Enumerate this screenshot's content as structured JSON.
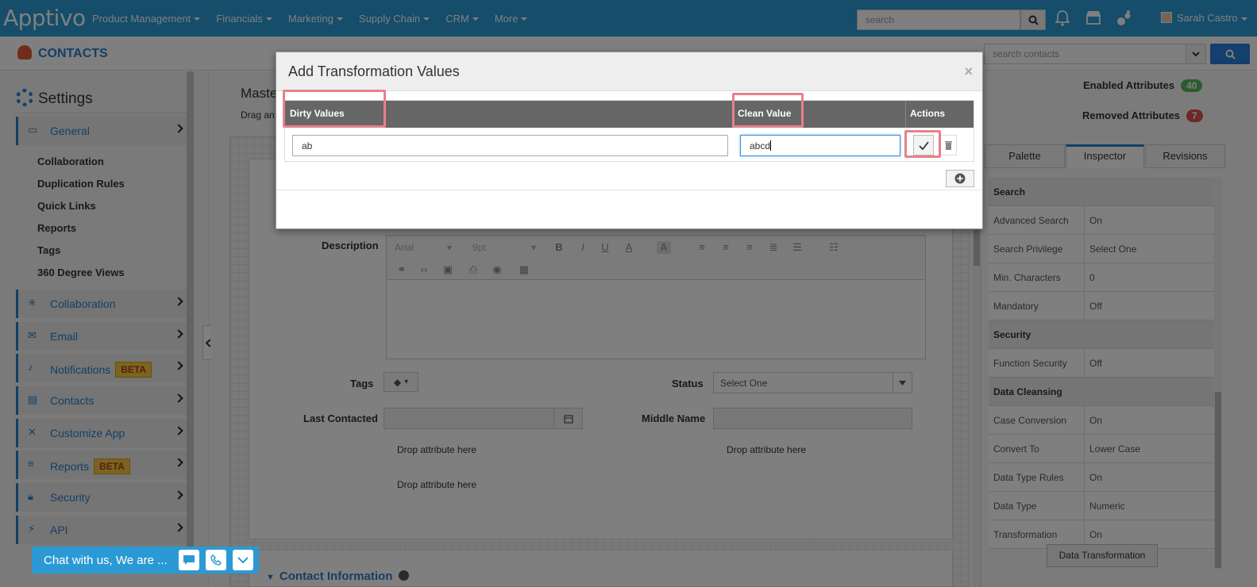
{
  "topnav": {
    "logo": "Apptivo",
    "items": [
      "Product Management",
      "Financials",
      "Marketing",
      "Supply Chain",
      "CRM",
      "More"
    ],
    "search_placeholder": "search",
    "user": "Sarah Castro"
  },
  "subbar": {
    "title": "CONTACTS",
    "contact_search_placeholder": "search contacts"
  },
  "sidebar": {
    "heading": "Settings",
    "general": "General",
    "sub_items": [
      "Collaboration",
      "Duplication Rules",
      "Quick Links",
      "Reports",
      "Tags",
      "360 Degree Views"
    ],
    "items": [
      {
        "label": "Collaboration",
        "icon": "collaboration-icon"
      },
      {
        "label": "Email",
        "icon": "envelope-icon"
      },
      {
        "label": "Notifications",
        "icon": "bell-icon",
        "badge": "BETA"
      },
      {
        "label": "Contacts",
        "icon": "contacts-card-icon"
      },
      {
        "label": "Customize App",
        "icon": "tools-icon"
      },
      {
        "label": "Reports",
        "icon": "reports-icon",
        "badge": "BETA"
      },
      {
        "label": "Security",
        "icon": "lock-icon"
      },
      {
        "label": "API",
        "icon": "plug-icon"
      }
    ]
  },
  "main": {
    "title": "Maste",
    "subtitle": "Drag an",
    "description_label": "Description",
    "editor": {
      "font": "Arial",
      "size": "9pt"
    },
    "tags_label": "Tags",
    "status_label": "Status",
    "status_value": "Select One",
    "last_contacted_label": "Last Contacted",
    "middle_name_label": "Middle Name",
    "drop_text": "Drop attribute here",
    "section": "Contact Information"
  },
  "right": {
    "enabled_label": "Enabled Attributes",
    "enabled_count": "40",
    "removed_label": "Removed Attributes",
    "removed_count": "7",
    "tabs": [
      "Palette",
      "Inspector",
      "Revisions"
    ],
    "inspector": [
      {
        "k": "Search",
        "head": true
      },
      {
        "k": "Advanced Search",
        "v": "On"
      },
      {
        "k": "Search Privilege",
        "v": "Select One"
      },
      {
        "k": "Min. Characters",
        "v": "0"
      },
      {
        "k": "Mandatory",
        "v": "Off"
      },
      {
        "k": "Security",
        "head": true
      },
      {
        "k": "Function Security",
        "v": "Off"
      },
      {
        "k": "Data Cleansing",
        "head": true
      },
      {
        "k": "Case Conversion",
        "v": "On"
      },
      {
        "k": "Convert To",
        "v": "Lower Case"
      },
      {
        "k": "Data Type Rules",
        "v": "On"
      },
      {
        "k": "Data Type",
        "v": "Numeric"
      },
      {
        "k": "Transformation",
        "v": "On"
      }
    ],
    "data_transformation_button": "Data Transformation"
  },
  "modal": {
    "title": "Add Transformation Values",
    "close": "×",
    "col_dirty": "Dirty Values",
    "col_clean": "Clean Value",
    "col_actions": "Actions",
    "dirty_value": "ab",
    "clean_value": "abcd"
  },
  "chat": {
    "text": "Chat with us, We are ..."
  }
}
